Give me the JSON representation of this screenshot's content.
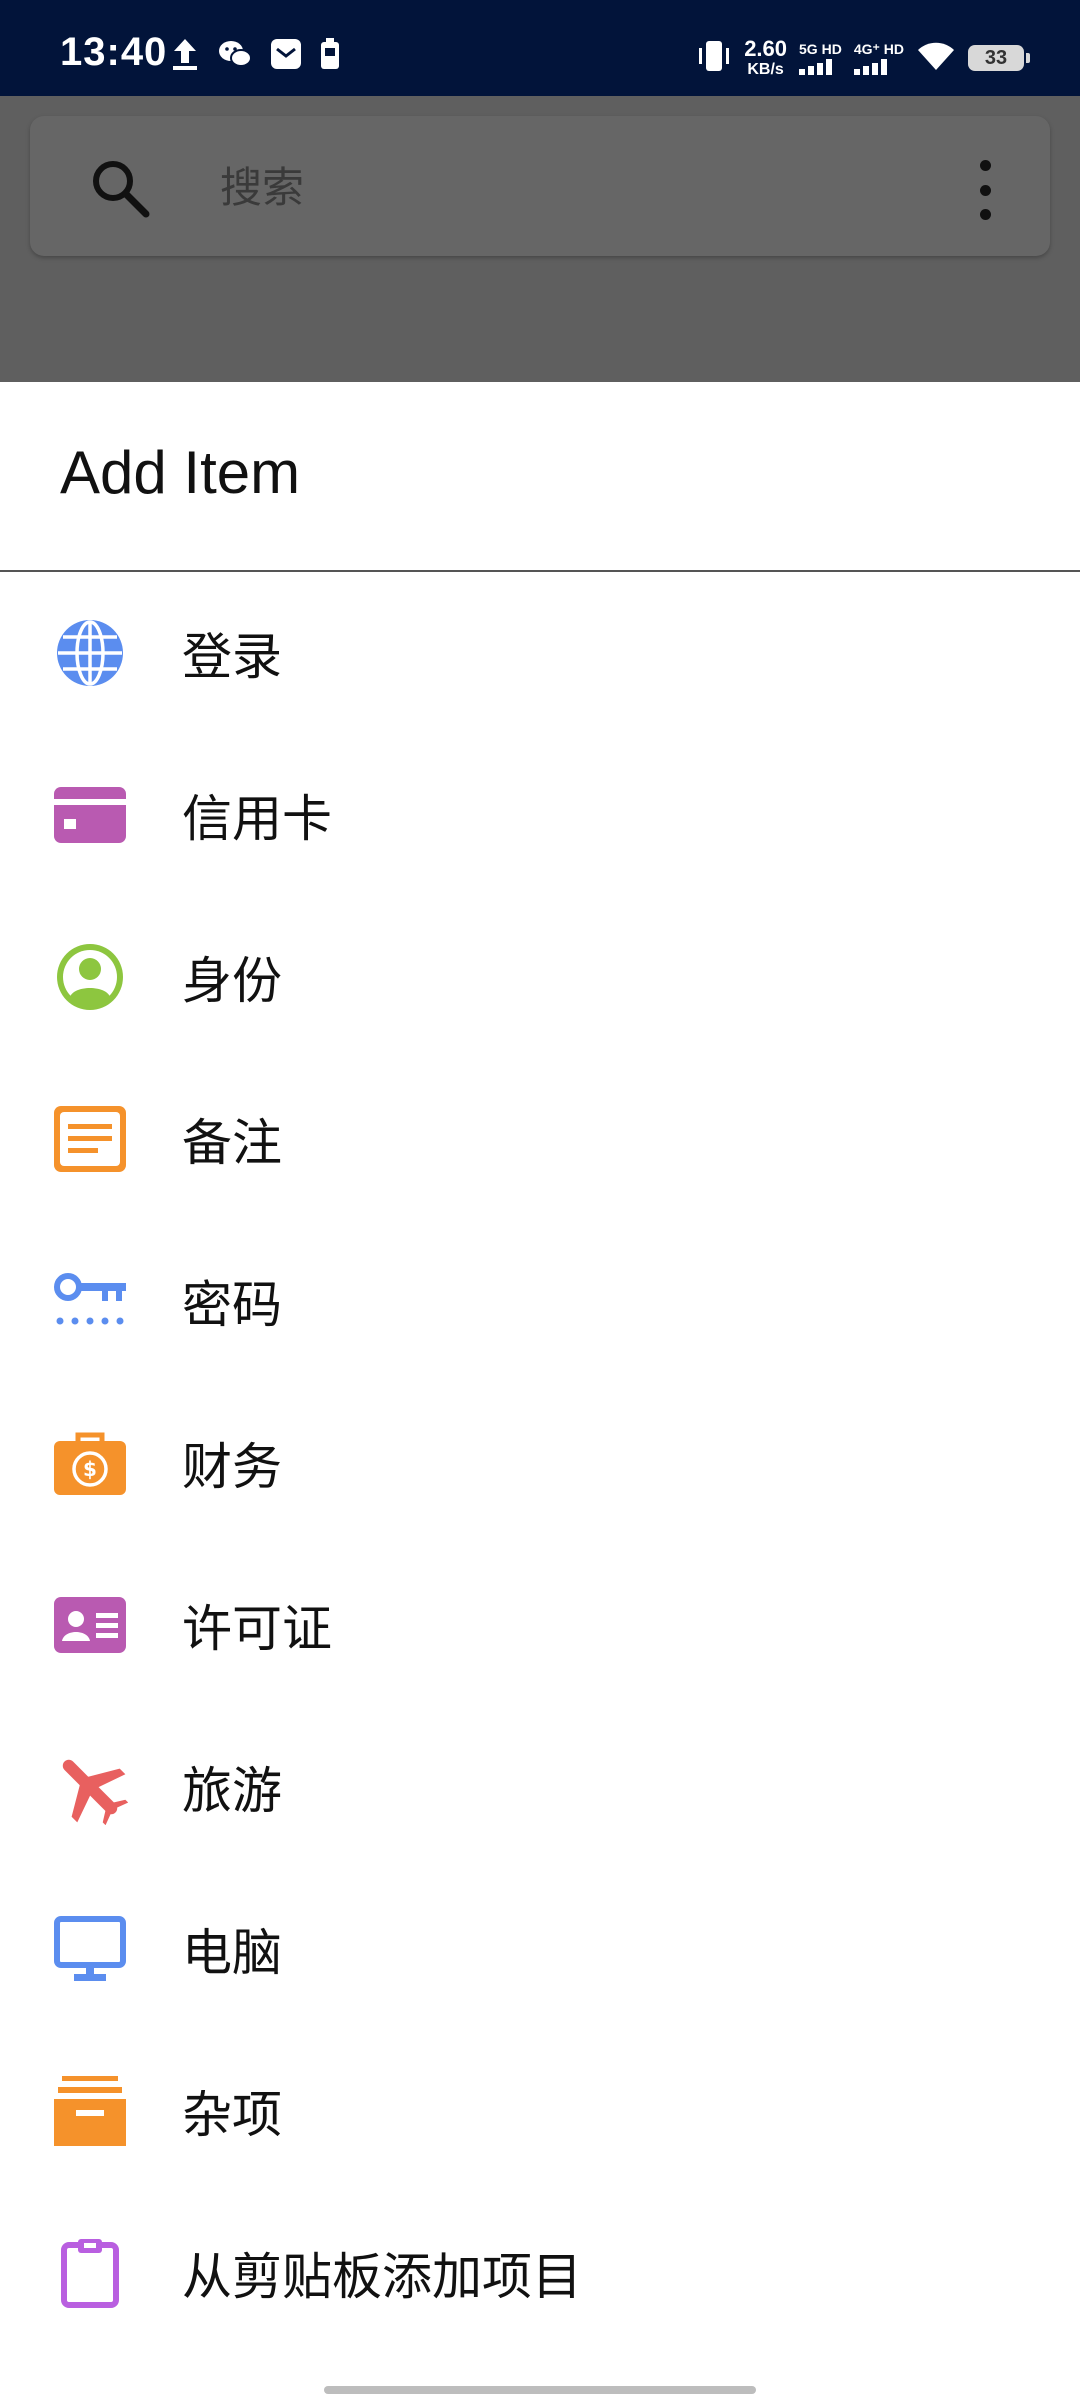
{
  "status_bar": {
    "time": "13:40",
    "net_speed_value": "2.60",
    "net_speed_unit": "KB/s",
    "sim1_label": "5G HD",
    "sim2_label": "4G⁺ HD",
    "battery": "33",
    "left_icons": [
      "upload-icon",
      "wechat-icon",
      "mail-notification-icon",
      "battery-saver-icon"
    ],
    "right_icons": [
      "vibrate-icon",
      "wifi-icon"
    ]
  },
  "search": {
    "placeholder": "搜索",
    "icon": "search-icon",
    "more_icon": "more-vert-icon"
  },
  "sheet": {
    "title": "Add Item",
    "items": [
      {
        "label": "登录",
        "icon": "globe-icon",
        "color": "#5b8def"
      },
      {
        "label": "信用卡",
        "icon": "credit-card-icon",
        "color": "#b95ab1"
      },
      {
        "label": "身份",
        "icon": "identity-icon",
        "color": "#8dc63f"
      },
      {
        "label": "备注",
        "icon": "note-icon",
        "color": "#f5922b"
      },
      {
        "label": "密码",
        "icon": "key-icon",
        "color": "#5b8def"
      },
      {
        "label": "财务",
        "icon": "finance-icon",
        "color": "#f5922b"
      },
      {
        "label": "许可证",
        "icon": "license-icon",
        "color": "#b95ab1"
      },
      {
        "label": "旅游",
        "icon": "airplane-icon",
        "color": "#e8605f"
      },
      {
        "label": "电脑",
        "icon": "computer-icon",
        "color": "#5b8def"
      },
      {
        "label": "杂项",
        "icon": "archive-icon",
        "color": "#f5922b"
      },
      {
        "label": "从剪贴板添加项目",
        "icon": "clipboard-icon",
        "color": "#b95fe0"
      }
    ]
  }
}
